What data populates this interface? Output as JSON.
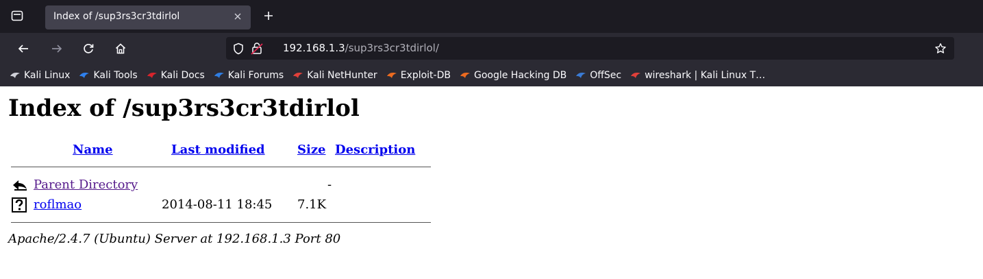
{
  "browser": {
    "tab": {
      "title": "Index of /sup3rs3cr3tdirlol",
      "close_icon": "close-icon"
    },
    "url": {
      "host": "192.168.1.3",
      "path": "/sup3rs3cr3tdirlol/"
    },
    "bookmarks": [
      {
        "label": "Kali Linux",
        "icon": "kali-dragon-icon",
        "color": "#cfd0d8"
      },
      {
        "label": "Kali Tools",
        "icon": "kali-tools-icon",
        "color": "#2f80ed"
      },
      {
        "label": "Kali Docs",
        "icon": "kali-docs-icon",
        "color": "#d8242c"
      },
      {
        "label": "Kali Forums",
        "icon": "kali-forums-icon",
        "color": "#2f7de1"
      },
      {
        "label": "Kali NetHunter",
        "icon": "kali-nethunter-icon",
        "color": "#e0403a"
      },
      {
        "label": "Exploit-DB",
        "icon": "exploit-db-icon",
        "color": "#ec6b20"
      },
      {
        "label": "Google Hacking DB",
        "icon": "ghdb-icon",
        "color": "#ec6b20"
      },
      {
        "label": "OffSec",
        "icon": "offsec-icon",
        "color": "#3a7bd5"
      },
      {
        "label": "wireshark | Kali Linux T…",
        "icon": "kali-nethunter-icon",
        "color": "#e0403a"
      }
    ]
  },
  "page": {
    "title": "Index of /sup3rs3cr3tdirlol",
    "columns": {
      "name": "Name",
      "modified": "Last modified",
      "size": "Size",
      "description": "Description"
    },
    "rows": [
      {
        "icon": "back-arrow-icon",
        "name": "Parent Directory",
        "modified": "",
        "size": "-",
        "description": ""
      },
      {
        "icon": "unknown-file-icon",
        "name": "roflmao",
        "modified": "2014-08-11 18:45",
        "size": "7.1K",
        "description": ""
      }
    ],
    "address": "Apache/2.4.7 (Ubuntu) Server at 192.168.1.3 Port 80"
  }
}
